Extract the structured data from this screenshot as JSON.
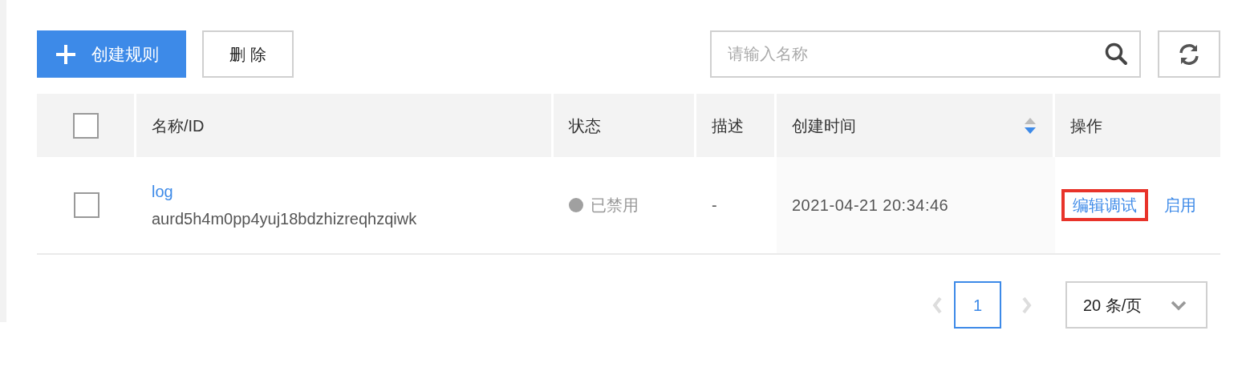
{
  "toolbar": {
    "create_button": "创建规则",
    "delete_button": "删 除",
    "search": {
      "placeholder": "请输入名称"
    }
  },
  "table": {
    "columns": [
      {
        "label": "名称/ID",
        "kind": "plain"
      },
      {
        "label": "状态",
        "kind": "plain"
      },
      {
        "label": "描述",
        "kind": "plain"
      },
      {
        "label": "创建时间",
        "kind": "sortable",
        "descending": true
      },
      {
        "label": "操作",
        "kind": "plain"
      }
    ],
    "header_checked": false,
    "rows": [
      {
        "checked": false,
        "name": "log",
        "id": "aurd5h4m0pp4yuj18bdzhizreqhzqiwk",
        "status": "已禁用",
        "color": "#a0a0a0",
        "description": "-",
        "created": "2021-04-21 20:34:46",
        "actions": [
          {
            "label": "编辑调试",
            "highlighted": true
          },
          {
            "label": "启用",
            "highlighted": false
          }
        ]
      }
    ]
  },
  "pagination": {
    "pages": [
      {
        "label": "1",
        "selected": true
      }
    ],
    "prev_disabled": true,
    "next_disabled": true,
    "page_size": "20 条/页"
  }
}
